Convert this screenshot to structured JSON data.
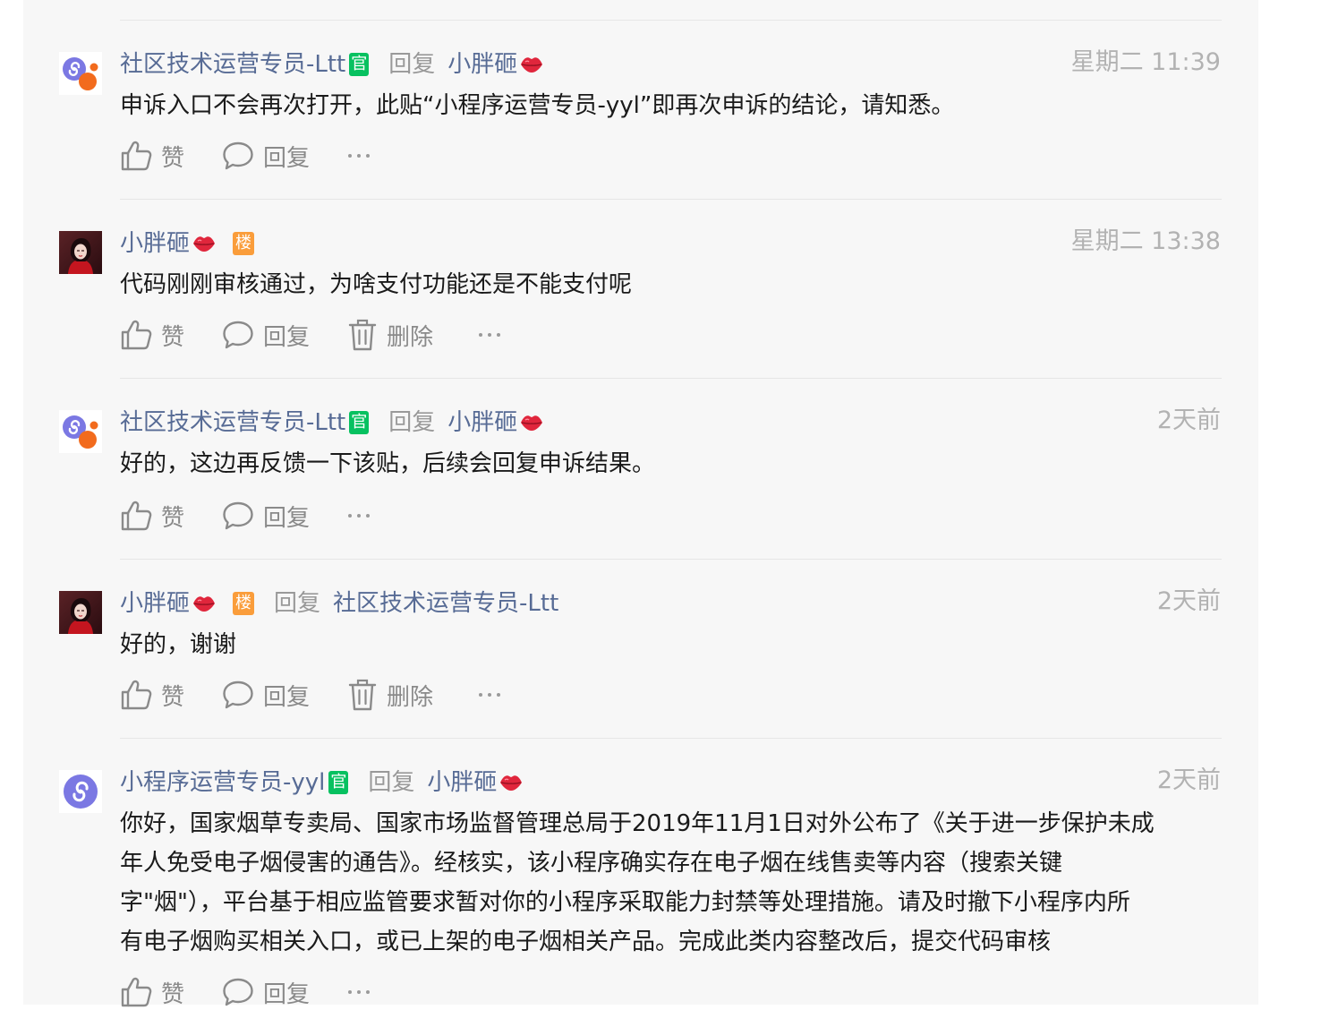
{
  "colors": {
    "name": "#576b95",
    "meta": "#999999",
    "time": "#b2b2b2",
    "text": "#1a1a1a",
    "official_badge": "#07c160",
    "floor_badge": "#fa9d3b",
    "panel_bg": "#f7f7f7"
  },
  "icons": {
    "like": "thumbs-up-icon",
    "reply": "comment-bubble-icon",
    "delete": "trash-icon",
    "more": "more-dots-icon",
    "emoji": "lips-emoji-icon"
  },
  "labels": {
    "like": "赞",
    "reply": "回复",
    "delete": "删除",
    "reply_to": "回复",
    "official": "官",
    "floor": "楼",
    "more": "···"
  },
  "comments": [
    {
      "author": "社区技术运营专员-Ltt",
      "avatar": "miniprogram-logo-orange",
      "official": true,
      "reply_to": "小胖砸",
      "time": "星期二 11:39",
      "lines": [
        "申诉入口不会再次打开，此贴“小程序运营专员-yyl”即再次申诉的结论，请知悉。"
      ],
      "can_delete": false
    },
    {
      "author": "小胖砸",
      "avatar": "user-photo",
      "floor": true,
      "time": "星期二 13:38",
      "lines": [
        "代码刚刚审核通过，为啥支付功能还是不能支付呢"
      ],
      "can_delete": true
    },
    {
      "author": "社区技术运营专员-Ltt",
      "avatar": "miniprogram-logo-orange",
      "official": true,
      "reply_to": "小胖砸",
      "time": "2天前",
      "lines": [
        "好的，这边再反馈一下该贴，后续会回复申诉结果。"
      ],
      "can_delete": false
    },
    {
      "author": "小胖砸",
      "avatar": "user-photo",
      "floor": true,
      "reply_to": "社区技术运营专员-Ltt",
      "time": "2天前",
      "lines": [
        "好的，谢谢"
      ],
      "can_delete": true
    },
    {
      "author": "小程序运营专员-yyl",
      "avatar": "miniprogram-logo-purple",
      "official": true,
      "reply_to": "小胖砸",
      "time": "2天前",
      "lines": [
        "你好，国家烟草专卖局、国家市场监督管理总局于2019年11月1日对外公布了《关于进一步保护未成",
        "年人免受电子烟侵害的通告》。经核实，该小程序确实存在电子烟在线售卖等内容（搜索关键",
        "字\"烟\"），平台基于相应监管要求暂对你的小程序采取能力封禁等处理措施。请及时撤下小程序内所",
        "有电子烟购买相关入口，或已上架的电子烟相关产品。完成此类内容整改后，提交代码审核"
      ],
      "can_delete": false
    }
  ]
}
